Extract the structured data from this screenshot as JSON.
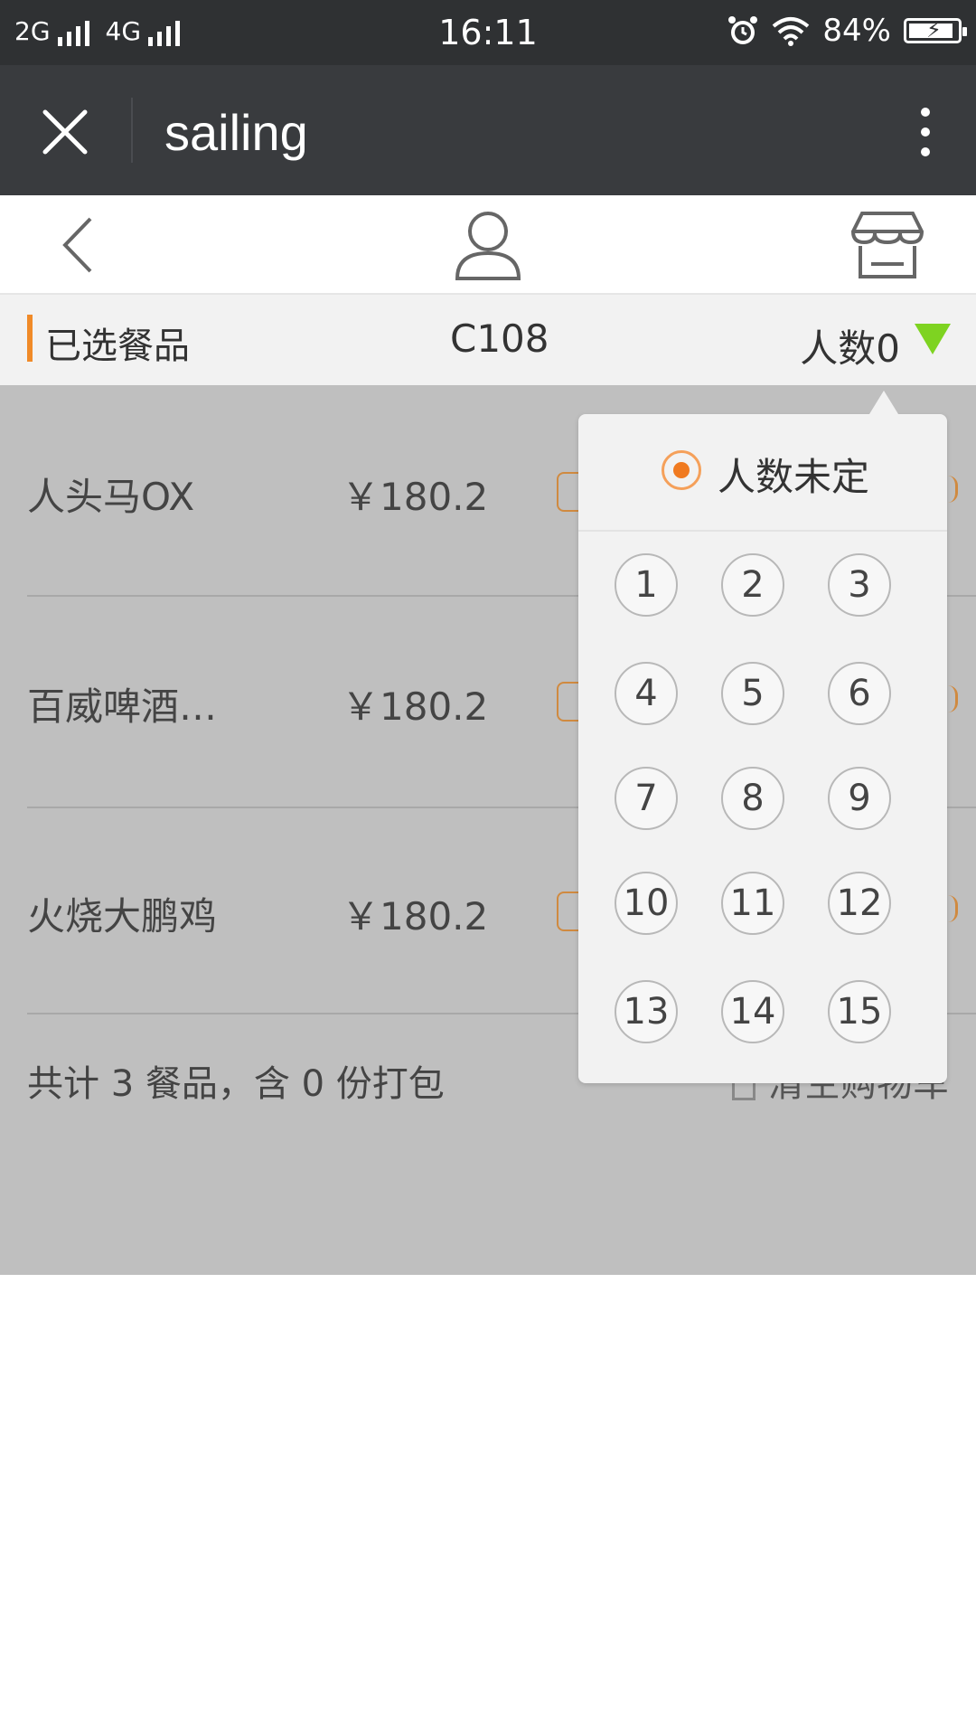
{
  "status_bar": {
    "network_1": "2G",
    "network_2": "4G",
    "time": "16:11",
    "battery": "84%"
  },
  "title_bar": {
    "title": "sailing"
  },
  "selected_bar": {
    "title": "已选餐品",
    "table": "C108",
    "people": "人数0",
    "accent_color": "#f08a28",
    "triangle_color": "#7ed321"
  },
  "items": [
    {
      "name": "人头马OX",
      "price": "￥180.2"
    },
    {
      "name": "百威啤酒…",
      "price": "￥180.2"
    },
    {
      "name": "火烧大鹏鸡",
      "price": "￥180.2"
    }
  ],
  "summary": "共计 3 餐品，含 0 份打包",
  "clear_cart": "清空购物车",
  "people_picker": {
    "undecided_label": "人数未定",
    "numbers": [
      "1",
      "2",
      "3",
      "4",
      "5",
      "6",
      "7",
      "8",
      "9",
      "10",
      "11",
      "12",
      "13",
      "14",
      "15"
    ]
  }
}
